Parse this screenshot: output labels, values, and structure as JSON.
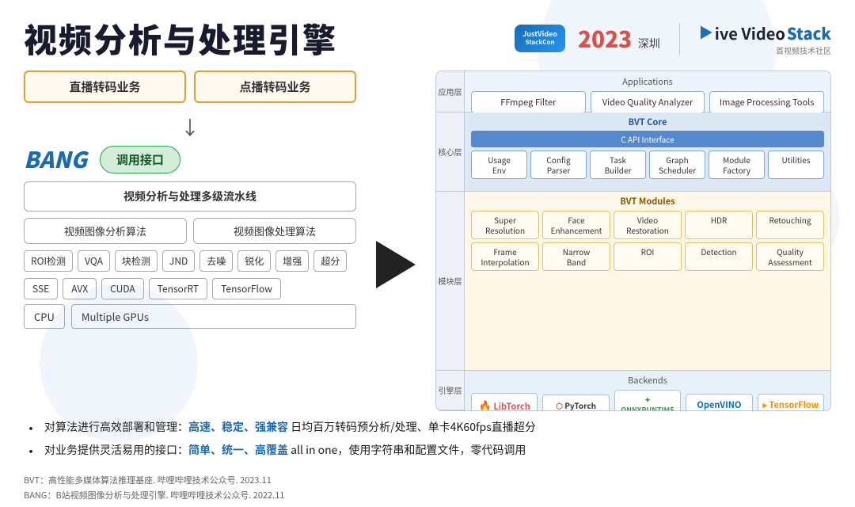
{
  "header": {
    "title": "视频分析与处理引擎",
    "logo": {
      "badge_line1": "JustVideo",
      "badge_line2": "StackCon",
      "year": "2023",
      "city": "深圳",
      "brand_prefix": "▶ive Video",
      "brand_suffix": "Stack",
      "brand_sub": "首视频技术社区"
    }
  },
  "left": {
    "arch_box1": "直播转码业务",
    "arch_box2": "点播转码业务",
    "bang_label": "BANG",
    "api_label": "调用接口",
    "pipeline": "视频分析与处理多级流水线",
    "algo1": "视频图像分析算法",
    "algo2": "视频图像处理算法",
    "tags": [
      "ROI检测",
      "VQA",
      "块检测",
      "JND",
      "去噪",
      "锐化",
      "增强",
      "超分"
    ],
    "tech1": [
      "SSE",
      "AVX",
      "CUDA"
    ],
    "tech2": [
      "TensorRT",
      "TensorFlow"
    ],
    "hw1": "CPU",
    "hw2": "Multiple GPUs"
  },
  "right": {
    "app_layer_label": "应用层",
    "core_layer_label": "核心层",
    "module_layer_label": "模块层",
    "backend_layer_label": "引擎层",
    "applications_title": "Applications",
    "apps": [
      "FFmpeg Filter",
      "Video Quality Analyzer",
      "Image Processing Tools"
    ],
    "bvt_core_title": "BVT Core",
    "capi": "C API Interface",
    "core_boxes": [
      {
        "line1": "Usage",
        "line2": "Env"
      },
      {
        "line1": "Config",
        "line2": "Parser"
      },
      {
        "line1": "Task",
        "line2": "Builder"
      },
      {
        "line1": "Graph",
        "line2": "Scheduler"
      },
      {
        "line1": "Module",
        "line2": "Factory"
      },
      {
        "line1": "Utilities",
        "line2": ""
      }
    ],
    "bvt_modules_title": "BVT Modules",
    "modules_row1": [
      {
        "line1": "Super",
        "line2": "Resolution"
      },
      {
        "line1": "Face",
        "line2": "Enhancement"
      },
      {
        "line1": "Video",
        "line2": "Restoration"
      },
      {
        "line1": "HDR",
        "line2": ""
      },
      {
        "line1": "Retouching",
        "line2": ""
      }
    ],
    "modules_row2": [
      {
        "line1": "Frame",
        "line2": "Interpolation"
      },
      {
        "line1": "Narrow",
        "line2": "Band"
      },
      {
        "line1": "ROI",
        "line2": ""
      },
      {
        "line1": "Detection",
        "line2": ""
      },
      {
        "line1": "Quality",
        "line2": "Assessment"
      }
    ],
    "backends_title": "Backends",
    "backends": [
      "LibTorch",
      "PyTorch",
      "ONNX RUNTIME",
      "OpenVINO",
      "TensorFlow"
    ]
  },
  "bullets": [
    {
      "prefix": "对算法进行高效部署和管理：",
      "highlight": "高速、稳定、强兼容",
      "suffix": " 日均百万转码预分析/处理、单卡4K60fps直播超分"
    },
    {
      "prefix": "对业务提供灵活易用的接口：",
      "highlight": "简单、统一、高覆盖",
      "suffix": " all in one，使用字符串和配置文件，零代码调用"
    }
  ],
  "footer": {
    "line1": "BVT：高性能多媒体算法推理基座. 哔哩哔哩技术公众号. 2023.11",
    "line2": "BANG：B站视频图像分析与处理引擎. 哔哩哔哩技术公众号. 2022.11"
  }
}
